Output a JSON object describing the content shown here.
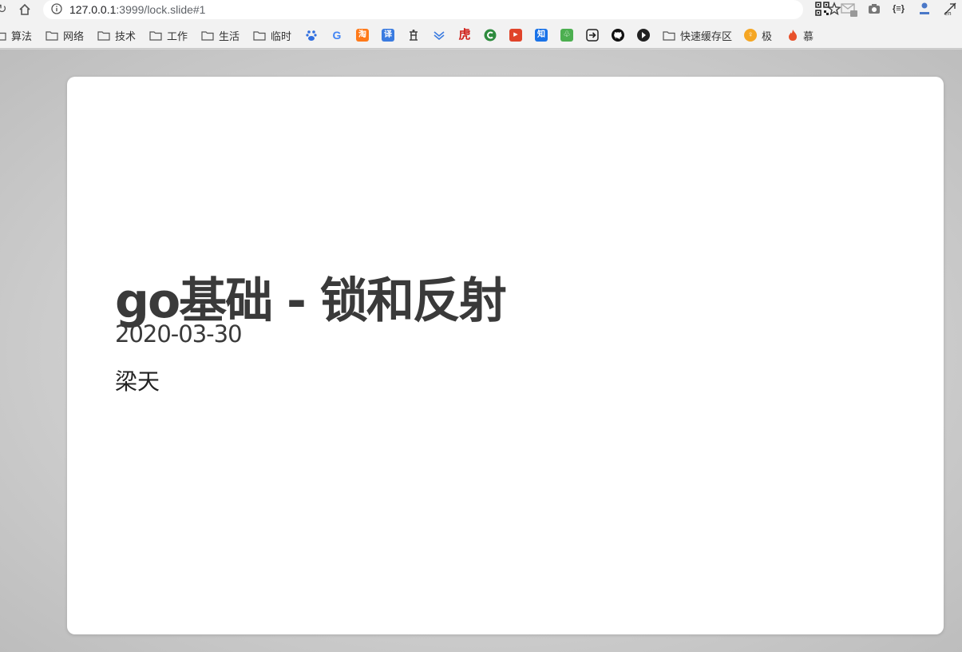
{
  "browser": {
    "url_host": "127.0.0.1",
    "url_rest": ":3999/lock.slide#1"
  },
  "bookmarks": {
    "folders": [
      "算法",
      "网络",
      "技术",
      "工作",
      "生活",
      "临时"
    ],
    "icons": [
      "baidu-icon",
      "google-icon",
      "taobao-icon",
      "translate-icon",
      "shrine-icon",
      "chevrons-icon",
      "tiger-icon",
      "c-icon",
      "video-icon",
      "zhihu-icon",
      "plant-icon",
      "arrow-box-icon",
      "github-icon",
      "compass-icon"
    ],
    "icon_glyphs": {
      "google": "G",
      "taobao": "淘",
      "translate": "译",
      "tiger": "虎",
      "zhihu": "知"
    },
    "quick_cache": "快速缓存区",
    "ji": "极",
    "mu": "慕"
  },
  "slide": {
    "title": "go基础 - 锁和反射",
    "date": "2020-03-30",
    "author": "梁天"
  },
  "colors": {
    "chrome_bg": "#f2f2f2",
    "page_bg": "#d4d4d4",
    "slide_bg": "#ffffff",
    "title_text": "#3a3a3a"
  }
}
